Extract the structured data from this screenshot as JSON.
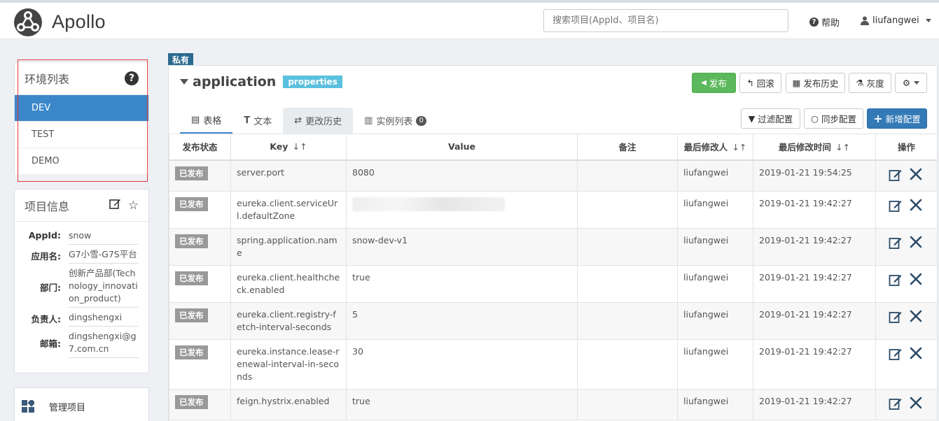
{
  "header": {
    "logo_text": "Apollo",
    "search_placeholder": "搜索项目(AppId、项目名)",
    "help_label": "帮助",
    "user_name": "liufangwei"
  },
  "env_panel": {
    "title": "环境列表",
    "items": [
      "DEV",
      "TEST",
      "DEMO"
    ],
    "active": "DEV"
  },
  "project_info": {
    "title": "项目信息",
    "fields": [
      {
        "label": "AppId:",
        "value": "snow"
      },
      {
        "label": "应用名:",
        "value": "G7小雪-G7S平台"
      },
      {
        "label": "部门:",
        "value": "创新产品部(Technology_innovation_product)"
      },
      {
        "label": "负责人:",
        "value": "dingshengxi"
      },
      {
        "label": "邮箱:",
        "value": "dingshengxi@g7.com.cn"
      }
    ]
  },
  "manage": {
    "label": "管理项目"
  },
  "namespace": {
    "private_tag": "私有",
    "name": "application",
    "format": "properties"
  },
  "actions": {
    "publish": "发布",
    "rollback": "回滚",
    "history": "发布历史",
    "gray": "灰度",
    "filter": "过滤配置",
    "sync": "同步配置",
    "add": "新增配置"
  },
  "tabs": {
    "table": "表格",
    "text": "文本",
    "change_history": "更改历史",
    "instances": "实例列表",
    "instance_count": "0"
  },
  "table": {
    "headers": [
      "发布状态",
      "Key",
      "Value",
      "备注",
      "最后修改人",
      "最后修改时间",
      "操作"
    ],
    "rows": [
      {
        "status": "已发布",
        "key": "server.port",
        "value": "8080",
        "comment": "",
        "modifier": "liufangwei",
        "time": "2019-01-21 19:54:25"
      },
      {
        "status": "已发布",
        "key": "eureka.client.serviceUrl.defaultZone",
        "value": "",
        "comment": "",
        "modifier": "liufangwei",
        "time": "2019-01-21 19:42:27"
      },
      {
        "status": "已发布",
        "key": "spring.application.name",
        "value": "snow-dev-v1",
        "comment": "",
        "modifier": "liufangwei",
        "time": "2019-01-21 19:42:27"
      },
      {
        "status": "已发布",
        "key": "eureka.client.healthcheck.enabled",
        "value": "true",
        "comment": "",
        "modifier": "liufangwei",
        "time": "2019-01-21 19:42:27"
      },
      {
        "status": "已发布",
        "key": "eureka.client.registry-fetch-interval-seconds",
        "value": "5",
        "comment": "",
        "modifier": "liufangwei",
        "time": "2019-01-21 19:42:27"
      },
      {
        "status": "已发布",
        "key": "eureka.instance.lease-renewal-interval-in-seconds",
        "value": "30",
        "comment": "",
        "modifier": "liufangwei",
        "time": "2019-01-21 19:42:27"
      },
      {
        "status": "已发布",
        "key": "feign.hystrix.enabled",
        "value": "true",
        "comment": "",
        "modifier": "liufangwei",
        "time": "2019-01-21 19:42:27"
      }
    ]
  }
}
